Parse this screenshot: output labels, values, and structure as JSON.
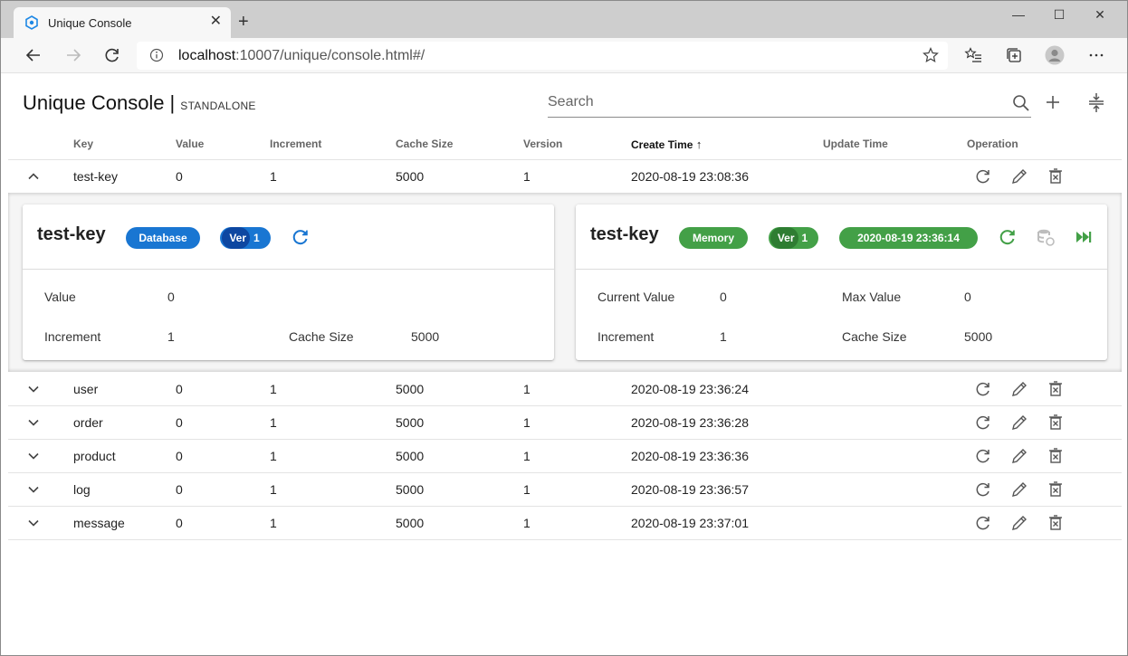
{
  "browser": {
    "tab_title": "Unique Console",
    "tab_close": "✕",
    "new_tab": "+",
    "url_host": "localhost",
    "url_rest": ":10007/unique/console.html#/",
    "win_min": "—",
    "win_max": "☐",
    "win_close": "✕"
  },
  "app": {
    "title": "Unique Console",
    "separator": "|",
    "mode": "STANDALONE",
    "search_placeholder": "Search"
  },
  "table": {
    "columns": [
      "Key",
      "Value",
      "Increment",
      "Cache Size",
      "Version",
      "Create Time",
      "Update Time",
      "Operation"
    ],
    "sort_arrow": "↑",
    "expanded_row": {
      "key": "test-key",
      "value": "0",
      "increment": "1",
      "cache_size": "5000",
      "version": "1",
      "create_time": "2020-08-19 23:08:36",
      "update_time": ""
    },
    "rows": [
      {
        "key": "user",
        "value": "0",
        "increment": "1",
        "cache_size": "5000",
        "version": "1",
        "create_time": "2020-08-19 23:36:24",
        "update_time": ""
      },
      {
        "key": "order",
        "value": "0",
        "increment": "1",
        "cache_size": "5000",
        "version": "1",
        "create_time": "2020-08-19 23:36:28",
        "update_time": ""
      },
      {
        "key": "product",
        "value": "0",
        "increment": "1",
        "cache_size": "5000",
        "version": "1",
        "create_time": "2020-08-19 23:36:36",
        "update_time": ""
      },
      {
        "key": "log",
        "value": "0",
        "increment": "1",
        "cache_size": "5000",
        "version": "1",
        "create_time": "2020-08-19 23:36:57",
        "update_time": ""
      },
      {
        "key": "message",
        "value": "0",
        "increment": "1",
        "cache_size": "5000",
        "version": "1",
        "create_time": "2020-08-19 23:37:01",
        "update_time": ""
      }
    ]
  },
  "db_card": {
    "key": "test-key",
    "source_chip": "Database",
    "ver_label": "Ver",
    "ver_value": "1",
    "value_label": "Value",
    "value": "0",
    "increment_label": "Increment",
    "increment": "1",
    "cache_size_label": "Cache Size",
    "cache_size": "5000"
  },
  "mem_card": {
    "key": "test-key",
    "source_chip": "Memory",
    "ver_label": "Ver",
    "ver_value": "1",
    "time_chip": "2020-08-19 23:36:14",
    "current_value_label": "Current Value",
    "current_value": "0",
    "max_value_label": "Max Value",
    "max_value": "0",
    "increment_label": "Increment",
    "increment": "1",
    "cache_size_label": "Cache Size",
    "cache_size": "5000"
  },
  "colors": {
    "db_blue": "#1976d2",
    "db_blue_dark": "#0d47a1",
    "mem_green": "#43a047",
    "mem_green_dark": "#2e7d32",
    "icon_gray": "#555555"
  }
}
